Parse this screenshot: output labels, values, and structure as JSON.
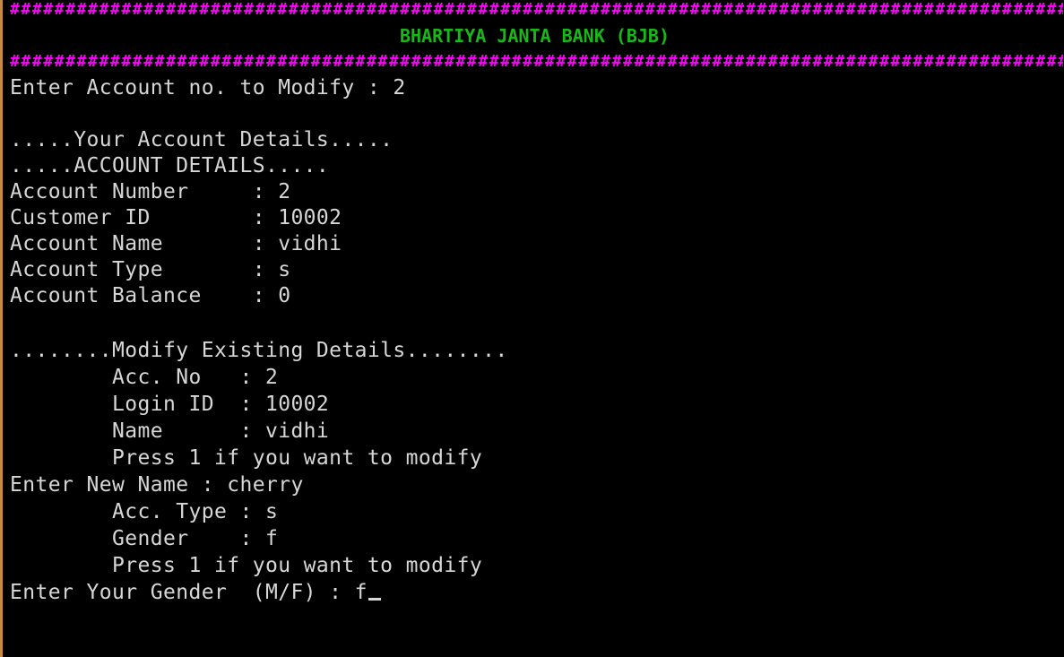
{
  "colors": {
    "background": "#000000",
    "text": "#d7d7d7",
    "border_rule": "#ff00ff",
    "title": "#18b818"
  },
  "header": {
    "rule": "##############################################################################################################",
    "title": "BHARTIYA JANTA BANK (BJB)"
  },
  "lines": [
    "Enter Account no. to Modify : 2",
    "",
    ".....Your Account Details.....",
    ".....ACCOUNT DETAILS.....",
    "Account Number     : 2",
    "Customer ID        : 10002",
    "Account Name       : vidhi",
    "Account Type       : s",
    "Account Balance    : 0",
    "",
    "........Modify Existing Details........",
    "        Acc. No   : 2",
    "        Login ID  : 10002",
    "        Name      : vidhi",
    "        Press 1 if you want to modify",
    "Enter New Name : cherry",
    "        Acc. Type : s",
    "        Gender    : f",
    "        Press 1 if you want to modify",
    "Enter Your Gender  (M/F) : f"
  ]
}
